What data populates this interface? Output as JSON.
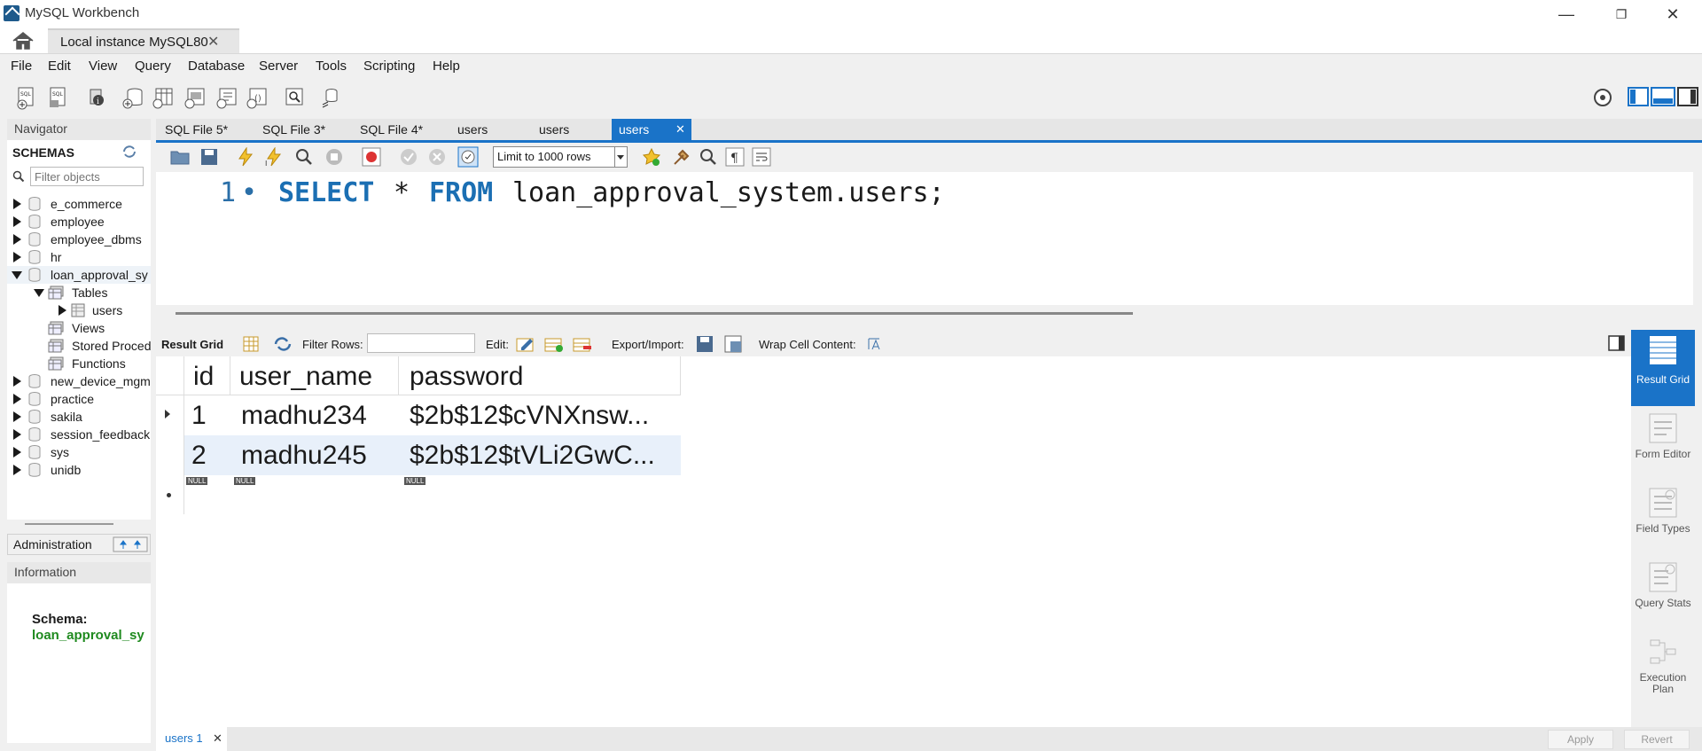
{
  "window": {
    "title": "MySQL Workbench",
    "minimize": "—",
    "restore": "❐",
    "close": "✕"
  },
  "connection_tab": {
    "label": "Local instance MySQL80",
    "close": "✕"
  },
  "menu": [
    "File",
    "Edit",
    "View",
    "Query",
    "Database",
    "Server",
    "Tools",
    "Scripting",
    "Help"
  ],
  "navigator": {
    "title": "Navigator",
    "schemas_label": "SCHEMAS",
    "filter_placeholder": "Filter objects",
    "schemas": [
      "e_commerce",
      "employee",
      "employee_dbms",
      "hr",
      "loan_approval_sy",
      "new_device_mgm",
      "practice",
      "sakila",
      "session_feedback",
      "sys",
      "unidb"
    ],
    "expanded": {
      "tables": "Tables",
      "users": "users",
      "views": "Views",
      "stored": "Stored Proced",
      "functions": "Functions"
    },
    "admin_tab": "Administration",
    "info_tab": "Information",
    "schema_label": "Schema:",
    "schema_value": "loan_approval_sy"
  },
  "sql_tabs": [
    {
      "label": "SQL File 5*",
      "active": false
    },
    {
      "label": "SQL File 3*",
      "active": false
    },
    {
      "label": "SQL File 4*",
      "active": false
    },
    {
      "label": "users",
      "active": false
    },
    {
      "label": "users",
      "active": false
    },
    {
      "label": "users",
      "active": true
    }
  ],
  "editor": {
    "limit_label": "Limit to 1000 rows",
    "line_number": "1",
    "keyword_select": "SELECT",
    "star": "*",
    "keyword_from": "FROM",
    "table_ref": "loan_approval_system.users;"
  },
  "result_toolbar": {
    "result_grid": "Result Grid",
    "filter_rows": "Filter Rows:",
    "edit": "Edit:",
    "export_import": "Export/Import:",
    "wrap": "Wrap Cell Content:"
  },
  "grid": {
    "columns": [
      "id",
      "user_name",
      "password"
    ],
    "rows": [
      [
        "1",
        "madhu234",
        "$2b$12$cVNXnsw..."
      ],
      [
        "2",
        "madhu245",
        "$2b$12$tVLi2GwC..."
      ]
    ],
    "null_label": "NULL"
  },
  "right_panel": [
    {
      "label": "Result Grid",
      "active": true
    },
    {
      "label": "Form Editor",
      "active": false
    },
    {
      "label": "Field Types",
      "active": false
    },
    {
      "label": "Query Stats",
      "active": false
    },
    {
      "label": "Execution Plan",
      "active": false
    }
  ],
  "bottom": {
    "result_tab": "users 1",
    "apply": "Apply",
    "revert": "Revert"
  },
  "colors": {
    "accent": "#1a73c8",
    "keyword": "#1b6fb3",
    "schema_green": "#1f8a1f"
  }
}
